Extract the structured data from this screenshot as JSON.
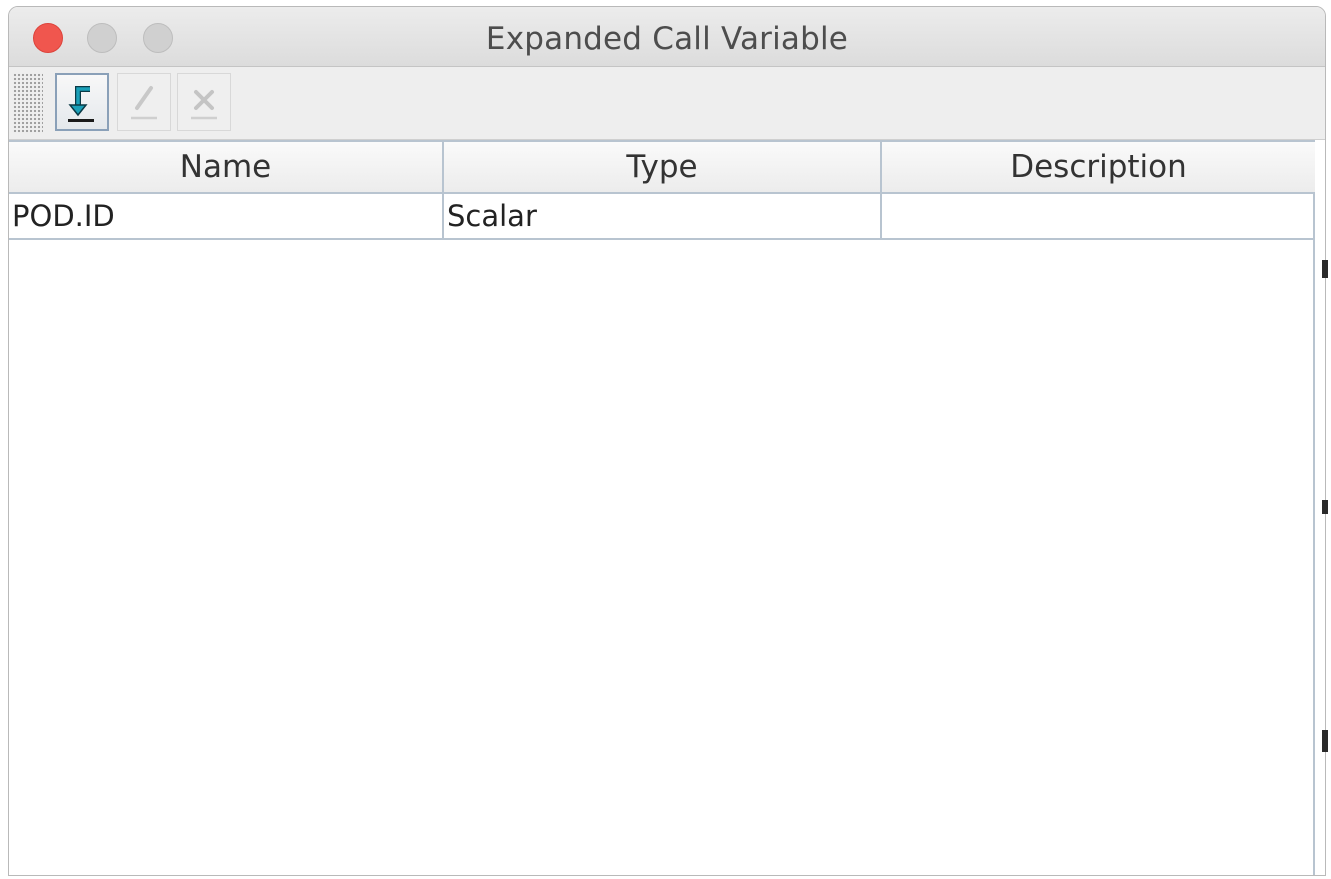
{
  "window": {
    "title": "Expanded Call Variable"
  },
  "toolbar": {
    "buttons": [
      {
        "icon": "import-arrow-icon",
        "state": "active"
      },
      {
        "icon": "pencil-icon",
        "state": "disabled"
      },
      {
        "icon": "delete-x-icon",
        "state": "disabled"
      }
    ]
  },
  "table": {
    "columns": [
      "Name",
      "Type",
      "Description"
    ],
    "rows": [
      {
        "name": "POD.ID",
        "type": "Scalar",
        "description": ""
      }
    ]
  },
  "colors": {
    "close_button": "#f0564e",
    "grid_line": "#b8c4d0",
    "accent_icon": "#1aa0b8"
  }
}
